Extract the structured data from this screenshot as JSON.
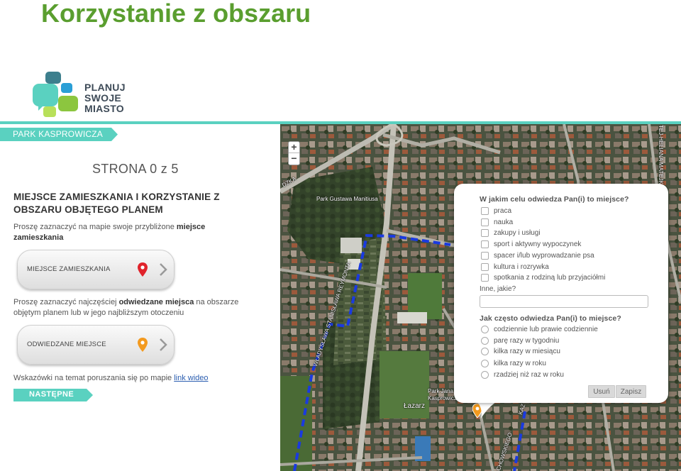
{
  "slide": {
    "title": "Korzystanie z obszaru"
  },
  "logo": {
    "line1": "PLANUJ",
    "line2": "SWOJE",
    "line3": "MIASTO"
  },
  "tab": {
    "label": "PARK KASPROWICZA"
  },
  "page_counter": "STRONA 0 z 5",
  "section": {
    "heading": "MIEJSCE ZAMIESZKANIA I KORZYSTANIE Z OBSZARU OBJĘTEGO PLANEM"
  },
  "intro1": {
    "before": "Proszę zaznaczyć na mapie swoje przybliżone ",
    "bold": "miejsce zamieszkania"
  },
  "button_home": {
    "label": "MIEJSCE ZAMIESZKANIA",
    "pin_color": "#e0232b"
  },
  "intro2": {
    "before": "Proszę zaznaczyć najczęściej ",
    "bold": "odwiedzane miejsca",
    "after": " na obszarze objętym planem lub w jego najbliższym otoczeniu"
  },
  "button_visited": {
    "label": "ODWIEDZANE MIEJSCE",
    "pin_color": "#f39a1f"
  },
  "hint": {
    "text": "Wskazówki na temat poruszania się po mapie ",
    "link": "link wideo"
  },
  "next_button": {
    "label": "NASTĘPNE"
  },
  "map": {
    "zoom_in": "+",
    "zoom_out": "−",
    "labels": {
      "park_manitiusa": "Park Gustawa Manitiusa",
      "street_reymonta": "WŁADYSŁAWA STANISŁAWA REYMONTA",
      "park_kasprowicza": "Park Jana Kasprowicza",
      "lazarz": "Łazarz",
      "street_top": "DZKA",
      "street_right": "TEJ-HELIANA MATEJKI",
      "street_bottom": "CHOWSKIEGO",
      "street_bottom2": "KAZ"
    },
    "colors": {
      "boundary": "#1a3ae0",
      "accent": "#5ad1c0",
      "pin": "#f39a1f"
    }
  },
  "popup": {
    "question1": "W jakim celu odwiedza Pan(i) to miejsce?",
    "purposes": [
      "praca",
      "nauka",
      "zakupy i usługi",
      "sport i aktywny wypoczynek",
      "spacer i/lub wyprowadzanie psa",
      "kultura i rozrywka",
      "spotkania z rodziną lub przyjaciółmi"
    ],
    "other_label": "Inne, jakie?",
    "other_value": "",
    "question2": "Jak często odwiedza Pan(i) to miejsce?",
    "frequencies": [
      "codziennie lub prawie codziennie",
      "parę razy w tygodniu",
      "kilka razy w miesiącu",
      "kilka razy w roku",
      "rzadziej niż raz w roku"
    ],
    "cancel": "Usuń",
    "save": "Zapisz"
  }
}
